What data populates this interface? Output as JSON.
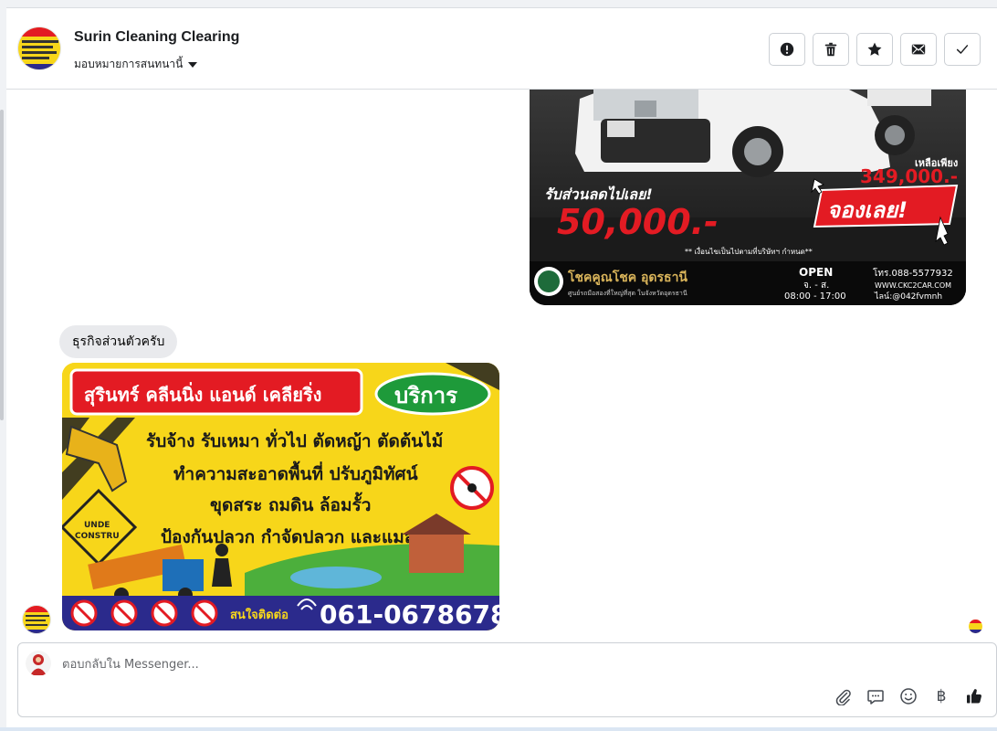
{
  "header": {
    "page_name": "Surin Cleaning Clearing",
    "assign_label": "มอบหมายการสนทนานี้",
    "actions": [
      {
        "name": "report-button",
        "icon": "exclamation-circle-icon"
      },
      {
        "name": "delete-button",
        "icon": "trash-icon"
      },
      {
        "name": "star-button",
        "icon": "star-icon"
      },
      {
        "name": "mark-unread-button",
        "icon": "envelope-icon"
      },
      {
        "name": "mark-done-button",
        "icon": "check-icon"
      }
    ]
  },
  "messages": {
    "car_ad": {
      "discount_label": "รับส่วนลดไปเลย!",
      "discount_amount": "50,000.-",
      "remaining_label": "เหลือเพียง",
      "price": "349,000.-",
      "cta": "จองเลย!",
      "terms": "** เงื่อนไขเป็นไปตามที่บริษัทฯ กำหนด**",
      "dealer_name": "โชคคูณโชค อุดรธานี",
      "dealer_sub": "ศูนย์รถมือสองที่ใหญ่ที่สุด ในจังหวัดอุดรธานี",
      "open_label": "OPEN",
      "days": "จ. - ส.",
      "hours": "08:00 - 17:00",
      "phone": "โทร.088-5577932",
      "website": "WWW.CKC2CAR.COM",
      "line": "ไลน์:@042fvmnh"
    },
    "text_bubble": "ธุรกิจส่วนตัวครับ",
    "service_ad": {
      "title": "สุรินทร์ คลีนนิ่ง แอนด์ เคลียริ่ง",
      "badge": "บริการ",
      "lines": [
        "รับจ้าง รับเหมา ทั่วไป ตัดหญ้า ตัดต้นไม้",
        "ทำความสะอาดพื้นที่ ปรับภูมิทัศน์",
        "ขุดสระ ถมดิน ล้อมรั้ว",
        "ป้องกันปลวก กำจัดปลวก และแมลง"
      ],
      "sign_text_1": "UNDE",
      "sign_text_2": "CONSTRU",
      "contact_label": "สนใจติดต่อ",
      "phone": "061-0678678"
    }
  },
  "composer": {
    "placeholder": "ตอบกลับใน Messenger...",
    "baht_symbol": "฿"
  },
  "colors": {
    "border": "#ccd0d5",
    "bubble": "#e9eaed",
    "red": "#e31b23",
    "yellow": "#f7d61a",
    "navy": "#2b2a8c",
    "green": "#1e9a3a"
  }
}
